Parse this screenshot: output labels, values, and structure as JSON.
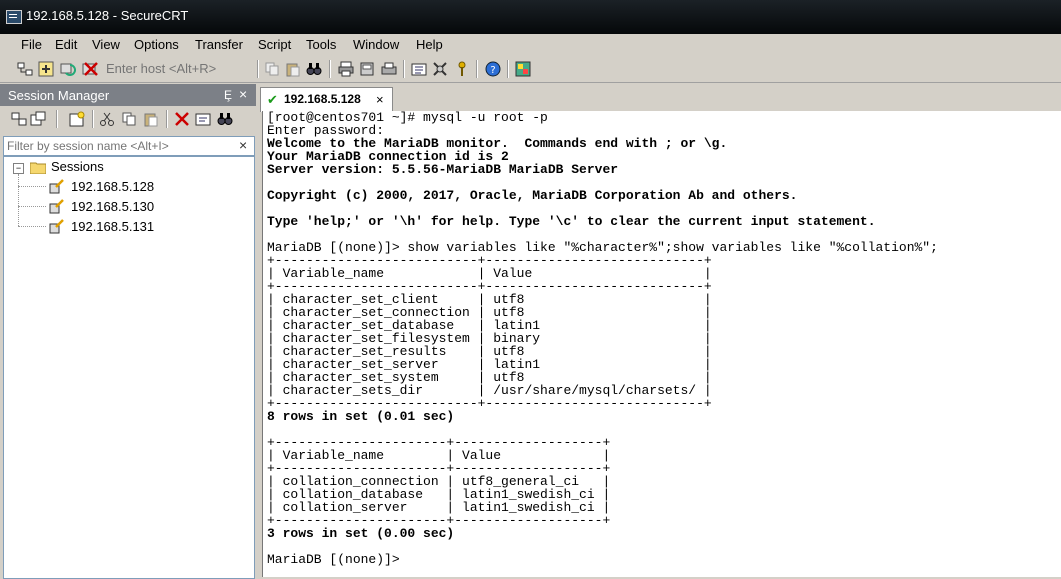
{
  "window": {
    "title": "192.168.5.128 - SecureCRT"
  },
  "menu": [
    "File",
    "Edit",
    "View",
    "Options",
    "Transfer",
    "Script",
    "Tools",
    "Window",
    "Help"
  ],
  "toolbar": {
    "host_placeholder": "Enter host <Alt+R>"
  },
  "session_manager": {
    "title": "Session Manager",
    "pin": "Ȩ",
    "close": "×",
    "filter_placeholder": "Filter by session name <Alt+I>",
    "filter_clear": "×",
    "root": "Sessions",
    "expander": "−",
    "sessions": [
      "192.168.5.128",
      "192.168.5.130",
      "192.168.5.131"
    ]
  },
  "tab": {
    "label": "192.168.5.128",
    "check": "✔",
    "close": "×"
  },
  "terminal": {
    "lines": [
      {
        "text": "[root@centos701 ~]# mysql -u root -p",
        "bold": false
      },
      {
        "text": "Enter password:",
        "bold": false
      },
      {
        "text": "Welcome to the MariaDB monitor.  Commands end with ; or \\g.",
        "bold": true
      },
      {
        "text": "Your MariaDB connection id is 2",
        "bold": true
      },
      {
        "text": "Server version: 5.5.56-MariaDB MariaDB Server",
        "bold": true
      },
      {
        "text": "",
        "bold": false
      },
      {
        "text": "Copyright (c) 2000, 2017, Oracle, MariaDB Corporation Ab and others.",
        "bold": true
      },
      {
        "text": "",
        "bold": false
      },
      {
        "text": "Type 'help;' or '\\h' for help. Type '\\c' to clear the current input statement.",
        "bold": true
      },
      {
        "text": "",
        "bold": false
      },
      {
        "text": "MariaDB [(none)]> show variables like \"%character%\";show variables like \"%collation%\";",
        "bold": false
      },
      {
        "text": "+--------------------------+----------------------------+",
        "bold": false
      },
      {
        "text": "| Variable_name            | Value                      |",
        "bold": false
      },
      {
        "text": "+--------------------------+----------------------------+",
        "bold": false
      },
      {
        "text": "| character_set_client     | utf8                       |",
        "bold": false
      },
      {
        "text": "| character_set_connection | utf8                       |",
        "bold": false
      },
      {
        "text": "| character_set_database   | latin1                     |",
        "bold": false
      },
      {
        "text": "| character_set_filesystem | binary                     |",
        "bold": false
      },
      {
        "text": "| character_set_results    | utf8                       |",
        "bold": false
      },
      {
        "text": "| character_set_server     | latin1                     |",
        "bold": false
      },
      {
        "text": "| character_set_system     | utf8                       |",
        "bold": false
      },
      {
        "text": "| character_sets_dir       | /usr/share/mysql/charsets/ |",
        "bold": false
      },
      {
        "text": "+--------------------------+----------------------------+",
        "bold": false
      },
      {
        "text": "8 rows in set (0.01 sec)",
        "bold": true
      },
      {
        "text": "",
        "bold": false
      },
      {
        "text": "+----------------------+-------------------+",
        "bold": false
      },
      {
        "text": "| Variable_name        | Value             |",
        "bold": false
      },
      {
        "text": "+----------------------+-------------------+",
        "bold": false
      },
      {
        "text": "| collation_connection | utf8_general_ci   |",
        "bold": false
      },
      {
        "text": "| collation_database   | latin1_swedish_ci |",
        "bold": false
      },
      {
        "text": "| collation_server     | latin1_swedish_ci |",
        "bold": false
      },
      {
        "text": "+----------------------+-------------------+",
        "bold": false
      },
      {
        "text": "3 rows in set (0.00 sec)",
        "bold": true
      },
      {
        "text": "",
        "bold": false
      },
      {
        "text": "MariaDB [(none)]> ",
        "bold": false
      }
    ]
  }
}
